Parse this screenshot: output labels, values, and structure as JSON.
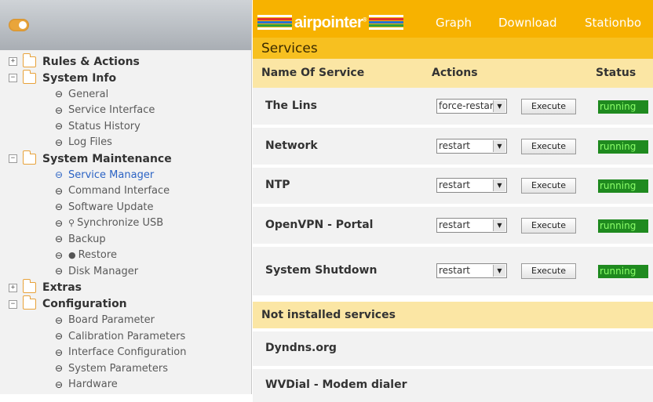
{
  "header": {
    "logo_text": "airpointer",
    "logo_mark": "®",
    "nav": [
      "Graph",
      "Download",
      "Stationbo"
    ],
    "stripe_colors": [
      "#ffffff",
      "#e03030",
      "#2a70d0",
      "#2aa040",
      "#ffffff"
    ]
  },
  "sidebar": {
    "toggle_icon": "toggle-switch-icon",
    "tree": [
      {
        "type": "folder",
        "expanded": false,
        "label": "Rules & Actions"
      },
      {
        "type": "folder",
        "expanded": true,
        "label": "System Info"
      },
      {
        "type": "link",
        "label": "General"
      },
      {
        "type": "link",
        "label": "Service Interface"
      },
      {
        "type": "link",
        "label": "Status History"
      },
      {
        "type": "link",
        "label": "Log Files"
      },
      {
        "type": "folder",
        "expanded": true,
        "label": "System Maintenance"
      },
      {
        "type": "link",
        "label": "Service Manager",
        "active": true
      },
      {
        "type": "link",
        "label": "Command Interface"
      },
      {
        "type": "link",
        "label": "Software Update"
      },
      {
        "type": "link",
        "label": "Synchronize USB",
        "sub_icon": "usb-icon"
      },
      {
        "type": "link",
        "label": "Backup"
      },
      {
        "type": "link",
        "label": "Restore",
        "sub_icon": "restore-icon"
      },
      {
        "type": "link",
        "label": "Disk Manager"
      },
      {
        "type": "folder",
        "expanded": false,
        "label": "Extras"
      },
      {
        "type": "folder",
        "expanded": true,
        "label": "Configuration"
      },
      {
        "type": "link",
        "label": "Board Parameter"
      },
      {
        "type": "link",
        "label": "Calibration Parameters"
      },
      {
        "type": "link",
        "label": "Interface Configuration"
      },
      {
        "type": "link",
        "label": "System Parameters"
      },
      {
        "type": "link",
        "label": "Hardware"
      }
    ]
  },
  "content": {
    "title": "Services",
    "columns": {
      "name": "Name Of Service",
      "actions": "Actions",
      "status": "Status"
    },
    "services": [
      {
        "name": "The Lins",
        "action": "force-restart",
        "execute_label": "Execute",
        "status": "running"
      },
      {
        "name": "Network",
        "action": "restart",
        "execute_label": "Execute",
        "status": "running"
      },
      {
        "name": "NTP",
        "action": "restart",
        "execute_label": "Execute",
        "status": "running"
      },
      {
        "name": "OpenVPN - Portal",
        "action": "restart",
        "execute_label": "Execute",
        "status": "running"
      },
      {
        "name": "System Shutdown",
        "action": "restart",
        "execute_label": "Execute",
        "status": "running"
      }
    ],
    "not_installed_title": "Not installed services",
    "not_installed": [
      "Dyndns.org",
      "WVDial - Modem dialer"
    ],
    "status_color": "#1f8a1f"
  }
}
